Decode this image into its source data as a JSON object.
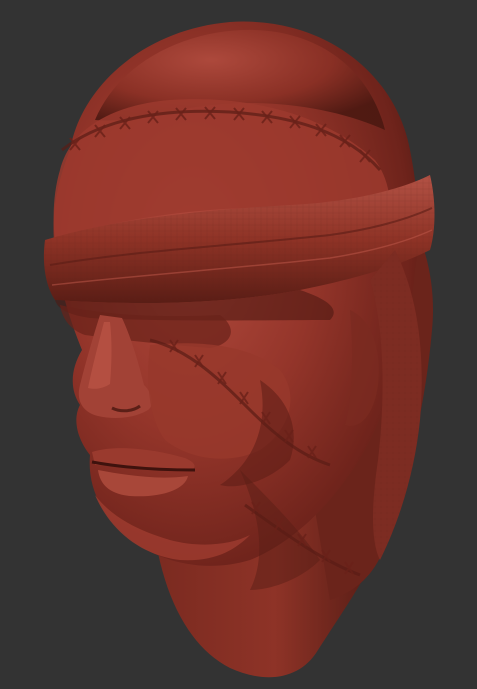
{
  "scene": {
    "subject": "sculpted-head",
    "background_color": "#333333",
    "material_color": "#8a2e22",
    "material_highlight": "#b2473a",
    "material_shadow": "#3e140f"
  }
}
